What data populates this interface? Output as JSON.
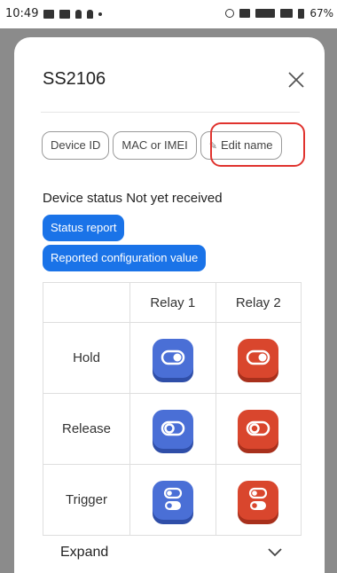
{
  "status_bar": {
    "time": "10:49",
    "battery": "67%"
  },
  "dialog": {
    "title": "SS2106",
    "chips": [
      "Device ID",
      "MAC or IMEI",
      "Edit name"
    ],
    "device_status_label": "Device status",
    "device_status_value": "Not yet received",
    "buttons": {
      "status_report": "Status report",
      "reported_config": "Reported configuration value"
    },
    "table": {
      "columns": [
        "",
        "Relay 1",
        "Relay 2"
      ],
      "rows": [
        "Hold",
        "Release",
        "Trigger"
      ]
    },
    "expand_label": "Expand"
  },
  "colors": {
    "accent_blue": "#1a73e8",
    "relay1": "#4a6fd6",
    "relay2": "#d9462d",
    "highlight": "#e0332e"
  }
}
